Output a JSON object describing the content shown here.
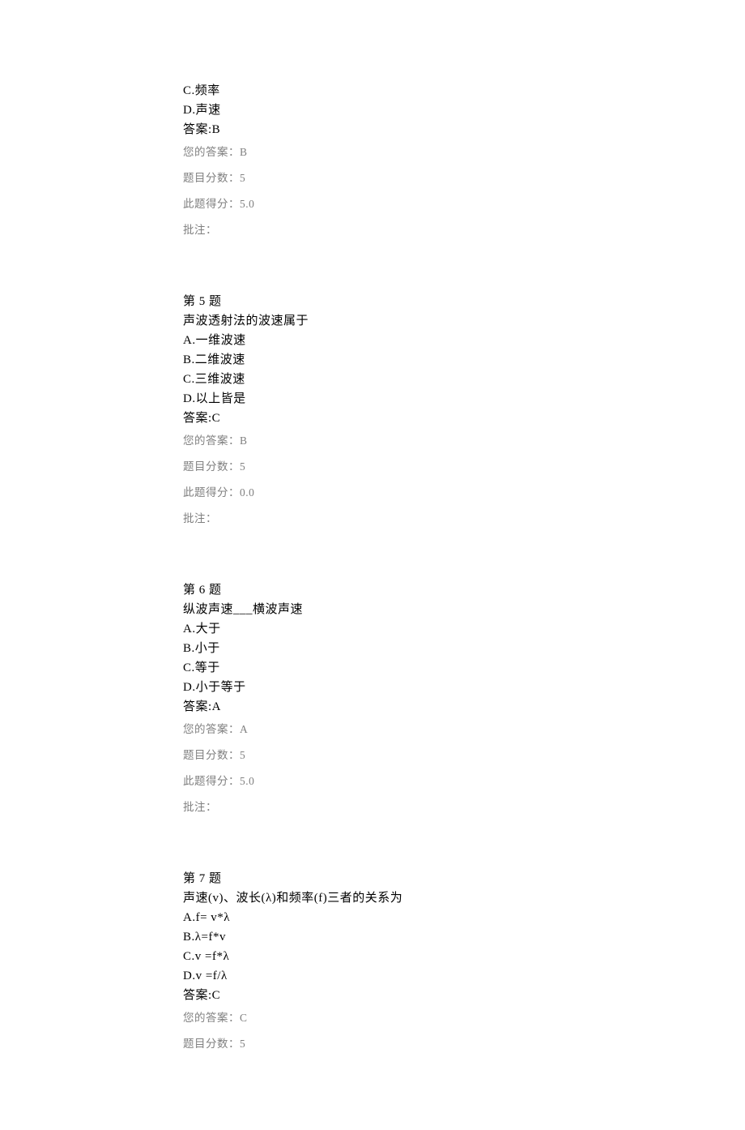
{
  "q4": {
    "optC": "C.频率",
    "optD": "D.声速",
    "answer": "答案:B",
    "userAnswer": "您的答案：B",
    "points": "题目分数：5",
    "score": "此题得分：5.0",
    "note": "批注："
  },
  "q5": {
    "title": "第 5 题",
    "stem": "声波透射法的波速属于",
    "optA": "A.一维波速",
    "optB": "B.二维波速",
    "optC": "C.三维波速",
    "optD": "D.以上皆是",
    "answer": "答案:C",
    "userAnswer": "您的答案：B",
    "points": "题目分数：5",
    "score": "此题得分：0.0",
    "note": "批注："
  },
  "q6": {
    "title": "第 6 题",
    "stem": "纵波声速___横波声速",
    "optA": "A.大于",
    "optB": "B.小于",
    "optC": "C.等于",
    "optD": "D.小于等于",
    "answer": "答案:A",
    "userAnswer": "您的答案：A",
    "points": "题目分数：5",
    "score": "此题得分：5.0",
    "note": "批注："
  },
  "q7": {
    "title": "第 7 题",
    "stem": "声速(v)、波长(λ)和频率(f)三者的关系为",
    "optA": "A.f= v*λ",
    "optB": "B.λ=f*v",
    "optC": "C.v =f*λ",
    "optD": "D.v =f/λ",
    "answer": "答案:C",
    "userAnswer": "您的答案：C",
    "points": "题目分数：5"
  }
}
